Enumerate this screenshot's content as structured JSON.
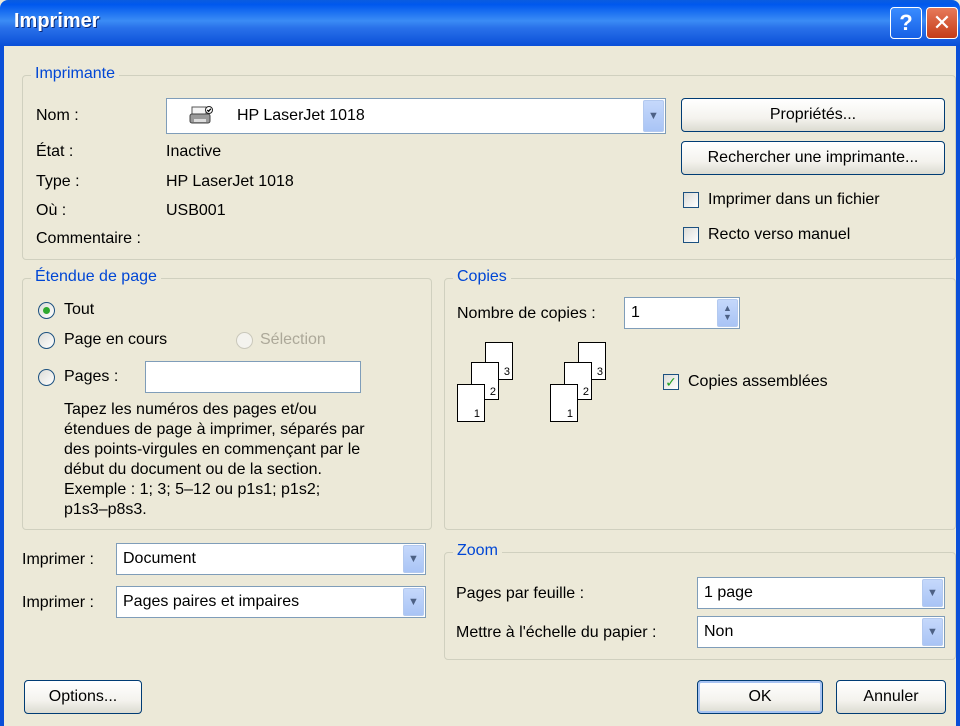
{
  "window": {
    "title": "Imprimer",
    "help_glyph": "?",
    "close_glyph": "✕"
  },
  "printer": {
    "legend": "Imprimante",
    "name_label": "Nom :",
    "name_value": "HP LaserJet 1018",
    "state_label": "État :",
    "state_value": "Inactive",
    "type_label": "Type :",
    "type_value": "HP LaserJet 1018",
    "where_label": "Où :",
    "where_value": "USB001",
    "comment_label": "Commentaire :",
    "properties_button": "Propriétés...",
    "find_button": "Rechercher une imprimante...",
    "print_to_file": {
      "label": "Imprimer dans un fichier",
      "checked": false
    },
    "manual_duplex": {
      "label": "Recto verso manuel",
      "checked": false
    },
    "icon": "printer-icon"
  },
  "page_range": {
    "legend": "Étendue de page",
    "all": {
      "label": "Tout",
      "selected": true
    },
    "current": {
      "label": "Page en cours",
      "selected": false
    },
    "selection": {
      "label": "Sélection",
      "enabled": false
    },
    "pages": {
      "label": "Pages :",
      "value": ""
    },
    "hint": "Tapez les numéros des pages et/ou\nétendues de page à imprimer, séparés par\ndes points-virgules en commençant par le\ndébut du document ou de la section.\nExemple : 1; 3; 5–12 ou p1s1; p1s2;\np1s3–p8s3."
  },
  "copies": {
    "legend": "Copies",
    "count_label": "Nombre de copies :",
    "count_value": "1",
    "collate": {
      "label": "Copies assemblées",
      "checked": true
    },
    "collated_pages": [
      "3",
      "2",
      "1"
    ]
  },
  "print_what": {
    "label": "Imprimer :",
    "value": "Document"
  },
  "print_pages": {
    "label": "Imprimer :",
    "value": "Pages paires et impaires"
  },
  "zoom": {
    "legend": "Zoom",
    "pages_per_sheet_label": "Pages par feuille :",
    "pages_per_sheet_value": "1 page",
    "scale_label": "Mettre à l'échelle du papier :",
    "scale_value": "Non"
  },
  "buttons": {
    "options": "Options...",
    "ok": "OK",
    "cancel": "Annuler"
  },
  "colors": {
    "title_blue": "#0a5ce0",
    "legend_blue": "#0046d5",
    "dialog_bg": "#ece9d8",
    "check_green": "#21a121"
  }
}
